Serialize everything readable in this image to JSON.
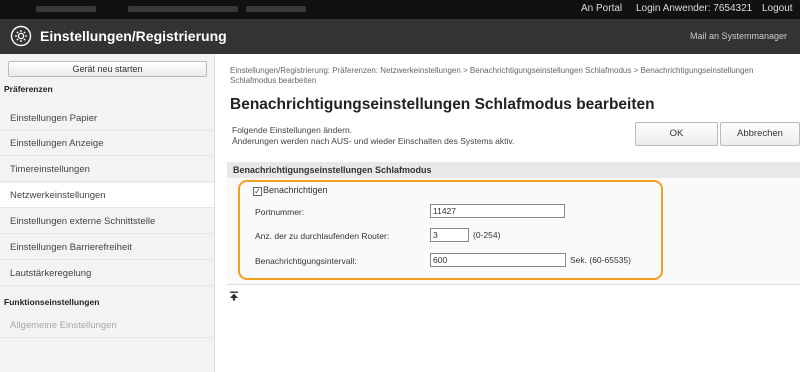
{
  "topbar": {
    "portal_link": "An Portal",
    "login_user": "Login Anwender:  7654321",
    "logout_link": "Logout"
  },
  "titlebar": {
    "title": "Einstellungen/Registrierung",
    "mail_link": "Mail an Systemmanager",
    "icon": "gear-icon"
  },
  "sidebar": {
    "restart_label": "Gerät neu starten",
    "preferences_heading": "Präferenzen",
    "items": [
      {
        "label": "Einstellungen Papier"
      },
      {
        "label": "Einstellungen Anzeige"
      },
      {
        "label": "Timereinstellungen"
      },
      {
        "label": "Netzwerkeinstellungen"
      },
      {
        "label": "Einstellungen externe Schnittstelle"
      },
      {
        "label": "Einstellungen Barrierefreiheit"
      },
      {
        "label": "Lautstärkeregelung"
      }
    ],
    "function_heading": "Funktionseinstellungen",
    "function_items": [
      {
        "label": "Allgemeine Einstellungen"
      }
    ]
  },
  "main": {
    "breadcrumb": "Einstellungen/Registrierung: Präferenzen: Netzwerkeinstellungen > Benachrichtigungseinstellungen Schlafmodus > Benachrichtigungseinstellungen Schlafmodus bearbeiten",
    "title": "Benachrichtigungseinstellungen Schlafmodus bearbeiten",
    "desc_line1": "Folgende Einstellungen ändern.",
    "desc_line2": "Änderungen werden nach AUS- und wieder Einschalten des Systems aktiv.",
    "ok_label": "OK",
    "cancel_label": "Abbrechen",
    "section_title": "Benachrichtigungseinstellungen Schlafmodus",
    "notify_label": "Benachrichtigen",
    "notify_checked": true,
    "port_label": "Portnummer:",
    "port_value": "11427",
    "router_label": "Anz. der zu durchlaufenden Router:",
    "router_value": "3",
    "router_range": "(0-254)",
    "interval_label": "Benachrichtigungsintervall:",
    "interval_value": "600",
    "interval_range": "Sek. (60-65535)"
  }
}
